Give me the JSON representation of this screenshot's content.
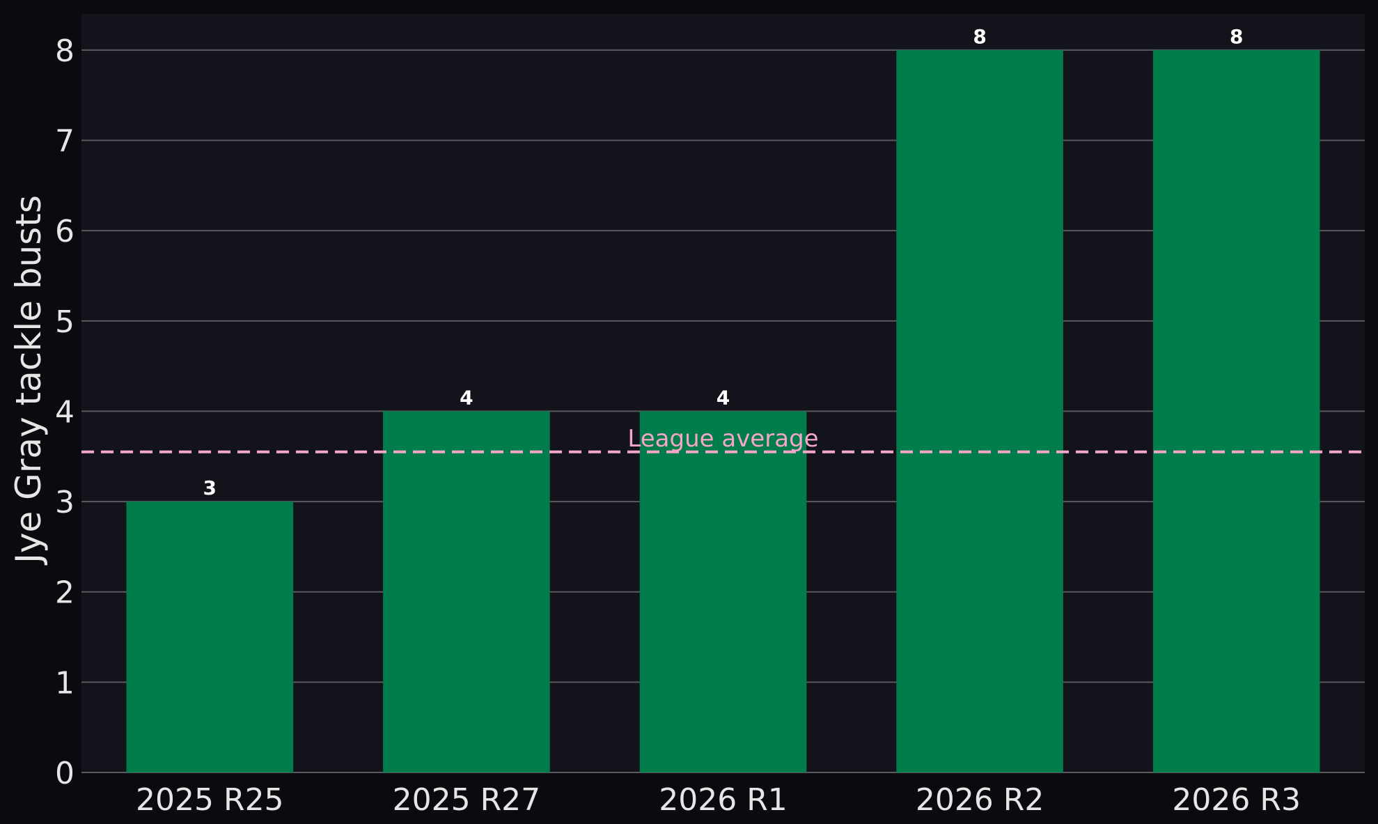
{
  "chart_data": {
    "type": "bar",
    "categories": [
      "2025 R25",
      "2025 R27",
      "2026 R1",
      "2026 R2",
      "2026 R3"
    ],
    "values": [
      3,
      4,
      4,
      8,
      8
    ],
    "value_labels": [
      "3",
      "4",
      "4",
      "8",
      "8"
    ],
    "title": "",
    "xlabel": "",
    "ylabel": "Jye Gray tackle busts",
    "ylim": [
      0,
      8.4
    ],
    "yticks": [
      0,
      1,
      2,
      3,
      4,
      5,
      6,
      7,
      8
    ],
    "ytick_labels": [
      "0",
      "1",
      "2",
      "3",
      "4",
      "5",
      "6",
      "7",
      "8"
    ],
    "grid": "horizontal",
    "reference_line": {
      "label": "League average",
      "value": 3.55,
      "style": "dashed",
      "color": "#f4a6c8"
    },
    "colors": {
      "bar": "#007d4a",
      "plot_background": "#13131b",
      "page_background": "#0b0b0f",
      "grid": "#5a5a60",
      "text": "#e6e6e6"
    }
  }
}
